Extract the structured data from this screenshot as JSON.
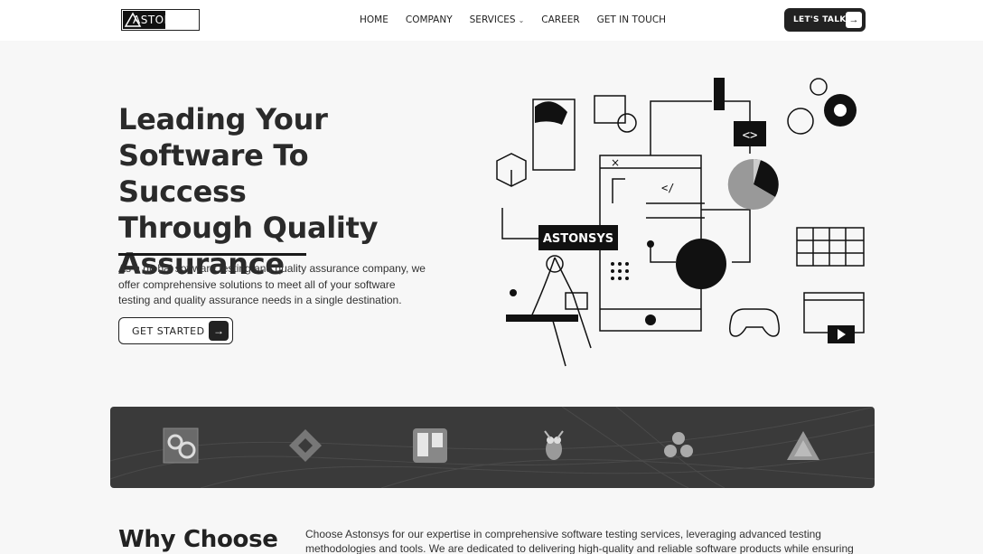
{
  "header": {
    "logo_text": "ASTONSYS",
    "nav": [
      {
        "label": "HOME"
      },
      {
        "label": "COMPANY"
      },
      {
        "label": "SERVICES"
      },
      {
        "label": "CAREER"
      },
      {
        "label": "GET IN TOUCH"
      }
    ],
    "cta_label": "LET'S TALK"
  },
  "hero": {
    "title_lines": [
      "Leading Your",
      "Software To Success",
      "Through Quality",
      "Assurance"
    ],
    "description": "As a global software testing and quality assurance company, we offer comprehensive solutions to meet all of your software testing and quality assurance needs in a single destination.",
    "button_label": "GET STARTED",
    "illustration_label": "ASTONSYS"
  },
  "tools": {
    "icons": [
      "automation-gear-icon",
      "jira-icon",
      "trello-icon",
      "mantis-icon",
      "asana-icon",
      "testrail-icon"
    ]
  },
  "why": {
    "title": "Why Choose",
    "text": "Choose Astonsys for our expertise in comprehensive software testing services, leveraging advanced testing methodologies and tools. We are dedicated to delivering high-quality and reliable software products while ensuring timely"
  },
  "colors": {
    "dark": "#222222",
    "band": "#3a3a3a",
    "background": "#f7f7f7"
  }
}
